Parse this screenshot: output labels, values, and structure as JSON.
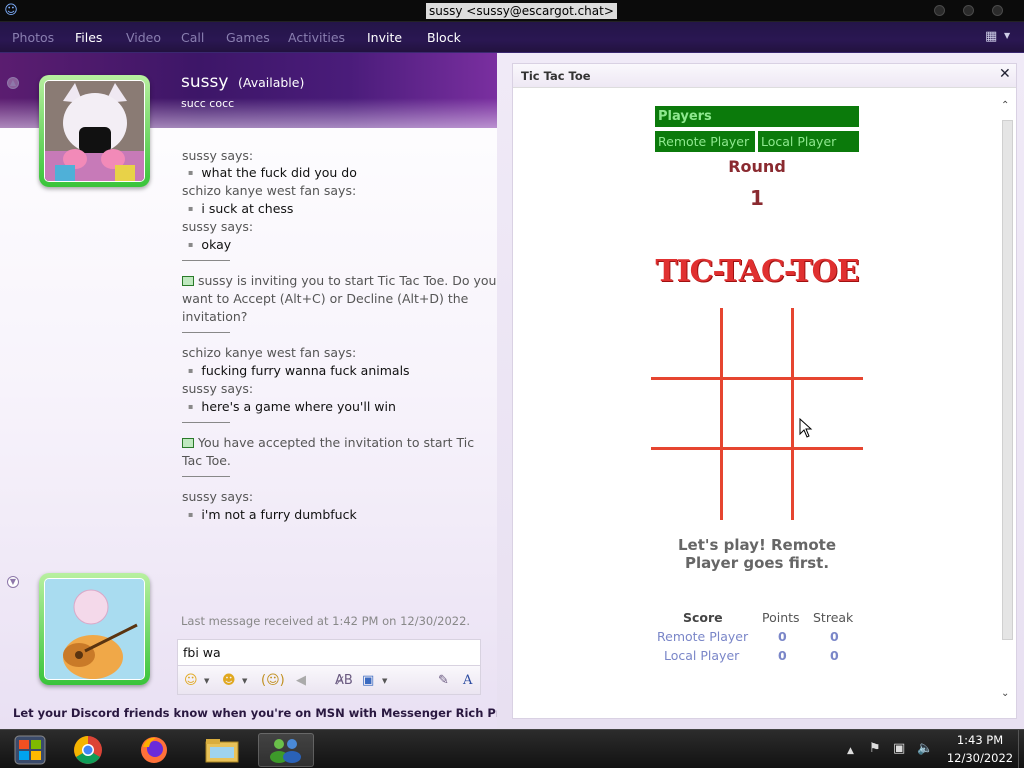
{
  "window": {
    "title": "sussy <sussy@escargot.chat>"
  },
  "menu": {
    "items": [
      {
        "label": "Photos",
        "enabled": false
      },
      {
        "label": "Files",
        "enabled": true
      },
      {
        "label": "Video",
        "enabled": false
      },
      {
        "label": "Call",
        "enabled": false
      },
      {
        "label": "Games",
        "enabled": false
      },
      {
        "label": "Activities",
        "enabled": false
      },
      {
        "label": "Invite",
        "enabled": true
      },
      {
        "label": "Block",
        "enabled": true
      }
    ],
    "options_icon": "layout-icon"
  },
  "contact": {
    "name": "sussy",
    "status": "(Available)",
    "personal_message": "succ cocc"
  },
  "conversation": {
    "messages": [
      {
        "kind": "says",
        "text": "sussy says:"
      },
      {
        "kind": "line",
        "text": "what the fuck did you do"
      },
      {
        "kind": "says",
        "text": "schizo kanye west fan says:"
      },
      {
        "kind": "line",
        "text": "i suck at chess"
      },
      {
        "kind": "says",
        "text": "sussy says:"
      },
      {
        "kind": "line",
        "text": "okay"
      },
      {
        "kind": "invite",
        "text": "sussy is inviting you to start Tic Tac Toe. Do you want to Accept (Alt+C) or Decline (Alt+D) the invitation?"
      },
      {
        "kind": "says",
        "text": "schizo kanye west fan says:"
      },
      {
        "kind": "line",
        "text": "fucking furry wanna fuck animals"
      },
      {
        "kind": "says",
        "text": "sussy says:"
      },
      {
        "kind": "line",
        "text": "here's a game where you'll win"
      },
      {
        "kind": "invite",
        "text": "You have accepted the invitation to start Tic Tac Toe."
      },
      {
        "kind": "says",
        "text": "sussy says:"
      },
      {
        "kind": "line",
        "text": "i'm not a furry dumbfuck"
      }
    ],
    "last_message": "Last message received at 1:42 PM on 12/30/2022.",
    "compose_text": "fbi wa",
    "ad_text": "Let your Discord friends know when you're on MSN with Messenger Rich Pres..."
  },
  "activity": {
    "title": "Tic Tac Toe",
    "players_label": "Players",
    "remote_player": "Remote Player",
    "local_player": "Local Player",
    "round_label": "Round",
    "round_number": "1",
    "logo_text": "TIC-TAC-TOE",
    "status_line1": "Let's play! Remote",
    "status_line2": "Player goes first.",
    "score": {
      "header_score": "Score",
      "header_points": "Points",
      "header_streak": "Streak",
      "rows": [
        {
          "name": "Remote Player",
          "points": "0",
          "streak": "0"
        },
        {
          "name": "Local Player",
          "points": "0",
          "streak": "0"
        }
      ]
    }
  },
  "taskbar": {
    "apps": [
      "windows-live-messenger-icon",
      "chrome-icon",
      "firefox-icon",
      "file-explorer-icon",
      "messenger-contacts-icon"
    ],
    "time": "1:43 PM",
    "date": "12/30/2022"
  },
  "colors": {
    "menu_bg": "#241548",
    "player_green": "#0b7a0b",
    "round_red": "#8a2a30",
    "grid_red": "#e64530",
    "score_blue": "#7a86c8"
  }
}
